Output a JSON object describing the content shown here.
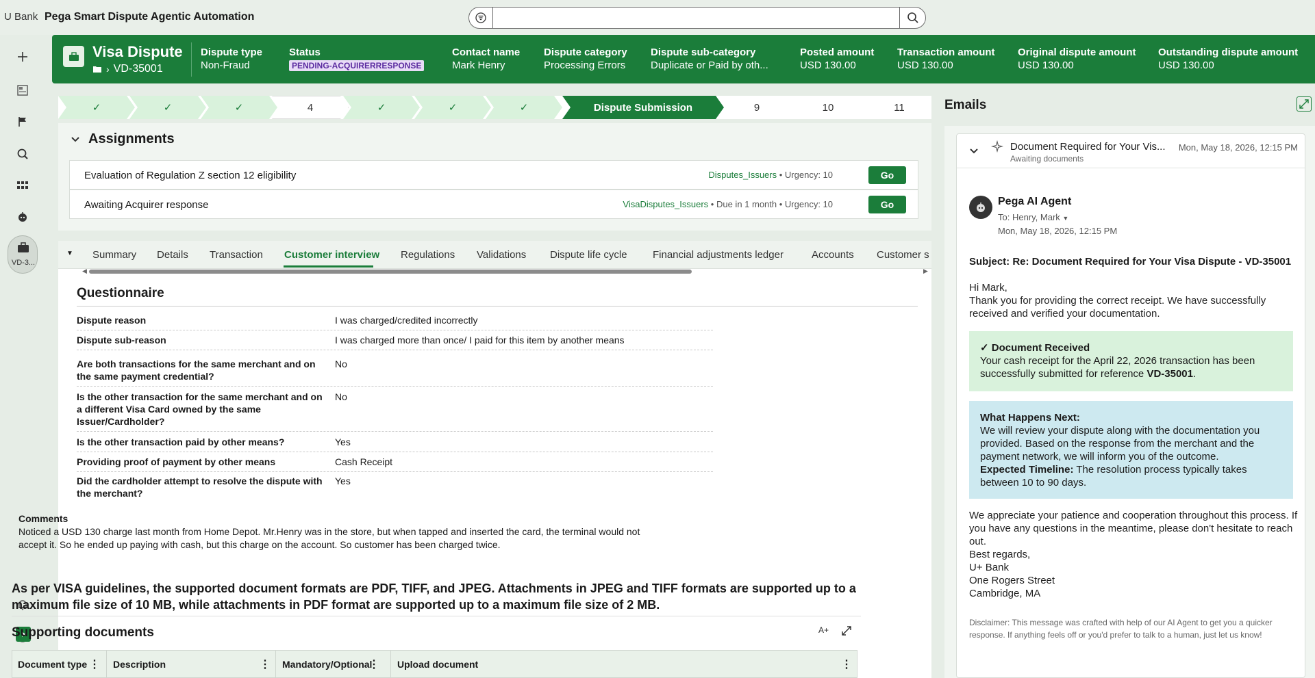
{
  "topbar": {
    "brand": "U Bank",
    "app_name": "Pega Smart Dispute Agentic Automation",
    "search_placeholder": ""
  },
  "rail": {
    "case_label": "VD-3..."
  },
  "header": {
    "case_title": "Visa Dispute",
    "case_id": "VD-35001",
    "fields": [
      {
        "key": "Dispute type",
        "value": "Non-Fraud"
      },
      {
        "key": "Status",
        "value": "PENDING-ACQUIRERRESPONSE"
      },
      {
        "key": "Contact name",
        "value": "Mark Henry"
      },
      {
        "key": "Dispute category",
        "value": "Processing Errors"
      },
      {
        "key": "Dispute sub-category",
        "value": "Duplicate or Paid by oth..."
      },
      {
        "key": "Posted amount",
        "value": "USD 130.00"
      },
      {
        "key": "Transaction amount",
        "value": "USD 130.00"
      },
      {
        "key": "Original dispute amount",
        "value": "USD 130.00"
      },
      {
        "key": "Outstanding dispute amount",
        "value": "USD 130.00"
      }
    ]
  },
  "stages": [
    {
      "label": "✓",
      "state": "done"
    },
    {
      "label": "✓",
      "state": "done"
    },
    {
      "label": "✓",
      "state": "done"
    },
    {
      "label": "4",
      "state": "todo"
    },
    {
      "label": "✓",
      "state": "done"
    },
    {
      "label": "✓",
      "state": "done"
    },
    {
      "label": "✓",
      "state": "done"
    },
    {
      "label": "Dispute Submission",
      "state": "active"
    },
    {
      "label": "9",
      "state": "todo"
    },
    {
      "label": "10",
      "state": "todo"
    },
    {
      "label": "11",
      "state": "todo"
    }
  ],
  "assignments": {
    "title": "Assignments",
    "rows": [
      {
        "title": "Evaluation of Regulation Z section 12 eligibility",
        "queue": "Disputes_Issuers",
        "sep": " • ",
        "extra": "",
        "urgency": "Urgency: 10",
        "go": "Go"
      },
      {
        "title": "Awaiting Acquirer response",
        "queue": "VisaDisputes_Issuers",
        "sep": " • ",
        "extra": "Due in 1 month • ",
        "urgency": "Urgency: 10",
        "go": "Go"
      }
    ]
  },
  "tabs": [
    "Summary",
    "Details",
    "Transaction",
    "Customer interview",
    "Regulations",
    "Validations",
    "Dispute life cycle",
    "Financial adjustments ledger",
    "Accounts",
    "Customer s"
  ],
  "questionnaire": {
    "title": "Questionnaire",
    "rows": [
      {
        "q": "Dispute reason",
        "a": "I was charged/credited incorrectly"
      },
      {
        "q": "Dispute sub-reason",
        "a": "I was charged more than once/ I paid for this item by another means"
      },
      {
        "q": "Are both transactions for the same merchant and on the same payment credential?",
        "a": "No"
      },
      {
        "q": "Is the other transaction for the same merchant and on a different Visa Card owned by the same Issuer/Cardholder?",
        "a": "No"
      },
      {
        "q": "Is the other transaction paid by other means?",
        "a": "Yes"
      },
      {
        "q": "Providing proof of payment by other means",
        "a": "Cash Receipt"
      },
      {
        "q": "Did the cardholder attempt to resolve the dispute with the merchant?",
        "a": "Yes"
      }
    ],
    "comments_label": "Comments",
    "comments": "Noticed a USD 130 charge last month from Home Depot. Mr.Henry was in the store, but when tapped and inserted the card, the terminal would not accept it. So he ended up paying with cash, but this charge on the account. So customer has been charged twice."
  },
  "guidelines": "As per VISA guidelines, the supported document formats are PDF, TIFF, and JPEG. Attachments in JPEG and TIFF formats are supported up to a maximum file size of 10 MB, while attachments in PDF format are supported up to a maximum file size of 2 MB.",
  "supporting_docs": {
    "title": "Supporting documents",
    "font_tool": "A+",
    "columns": [
      "Document type",
      "Description",
      "Mandatory/Optional",
      "Upload document"
    ]
  },
  "emails": {
    "title": "Emails",
    "subject_short": "Document Required for Your Vis...",
    "status": "Awaiting documents",
    "date": "Mon, May 18, 2026, 12:15 PM",
    "sender": "Pega AI Agent",
    "to": "To: Henry, Mark",
    "sent": "Mon, May 18, 2026, 12:15 PM",
    "subject_full": "Subject: Re: Document Required for Your Visa Dispute - VD-35001",
    "greeting": "Hi Mark,",
    "intro": "Thank you for providing the correct receipt. We have successfully received and verified your documentation.",
    "received_title": "✓ Document Received",
    "received_text": "Your cash receipt for the April 22, 2026 transaction has been successfully submitted for reference ",
    "received_ref": "VD-35001",
    "received_end": ".",
    "next_title": "What Happens Next:",
    "next_text": "We will review your dispute along with the documentation you provided. Based on the response from the merchant and the payment network, we will inform you of the outcome.",
    "timeline_label": "Expected Timeline:",
    "timeline_text": " The resolution process typically takes between 10 to 90 days.",
    "closing": "We appreciate your patience and cooperation throughout this process. If you have any questions in the meantime, please don't hesitate to reach out.",
    "signoff": "Best regards,",
    "org": "U+ Bank",
    "street": "One Rogers Street",
    "city": "Cambridge, MA",
    "disclaimer": "Disclaimer: This message was crafted with help of our AI Agent to get you a quicker response. If anything feels off or you'd prefer to talk to a human, just let us know!"
  },
  "colors": {
    "brand_green": "#1b7d3a",
    "badge_bg": "#e8dcf7",
    "badge_text": "#5b2ca0"
  }
}
